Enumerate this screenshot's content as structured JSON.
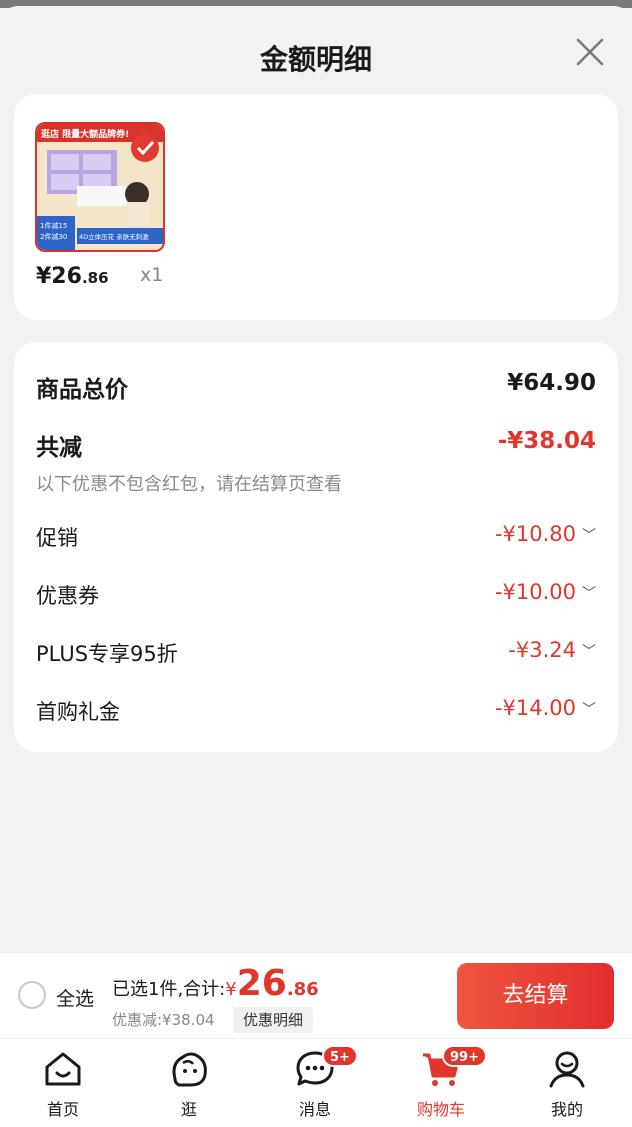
{
  "sheet": {
    "title": "金额明细"
  },
  "product": {
    "price_main": "¥26",
    "price_cents": ".86",
    "quantity": "x1",
    "image_texts": {
      "banner": "逛店 限量大额品牌券!",
      "promo_line1": "1件减15",
      "promo_line2": "2件减30",
      "tag": "4D立体压花 亲肤无刺激"
    }
  },
  "summary": {
    "total_label": "商品总价",
    "total_value": "¥64.90",
    "discount_label": "共减",
    "discount_value": "-¥38.04",
    "note": "以下优惠不包含红包，请在结算页查看",
    "items": [
      {
        "label": "促销",
        "value": "-¥10.80"
      },
      {
        "label": "优惠券",
        "value": "-¥10.00"
      },
      {
        "label": "PLUS专享95折",
        "value": "-¥3.24"
      },
      {
        "label": "首购礼金",
        "value": "-¥14.00"
      }
    ]
  },
  "bottom_bar": {
    "select_all": "全选",
    "selected_prefix": "已选1件,合计:",
    "yen": "¥",
    "total_int": "26",
    "total_cents": ".86",
    "discount_text": "优惠减:¥38.04",
    "detail_chip": "优惠明细",
    "checkout": "去结算"
  },
  "tabbar": {
    "tabs": [
      {
        "label": "首页",
        "icon": "home-icon"
      },
      {
        "label": "逛",
        "icon": "browse-icon"
      },
      {
        "label": "消息",
        "icon": "message-icon",
        "badge": "5+"
      },
      {
        "label": "购物车",
        "icon": "cart-icon",
        "badge": "99+",
        "active": true
      },
      {
        "label": "我的",
        "icon": "profile-icon"
      }
    ]
  },
  "colors": {
    "accent": "#e1362c",
    "background": "#f2f2f2"
  }
}
